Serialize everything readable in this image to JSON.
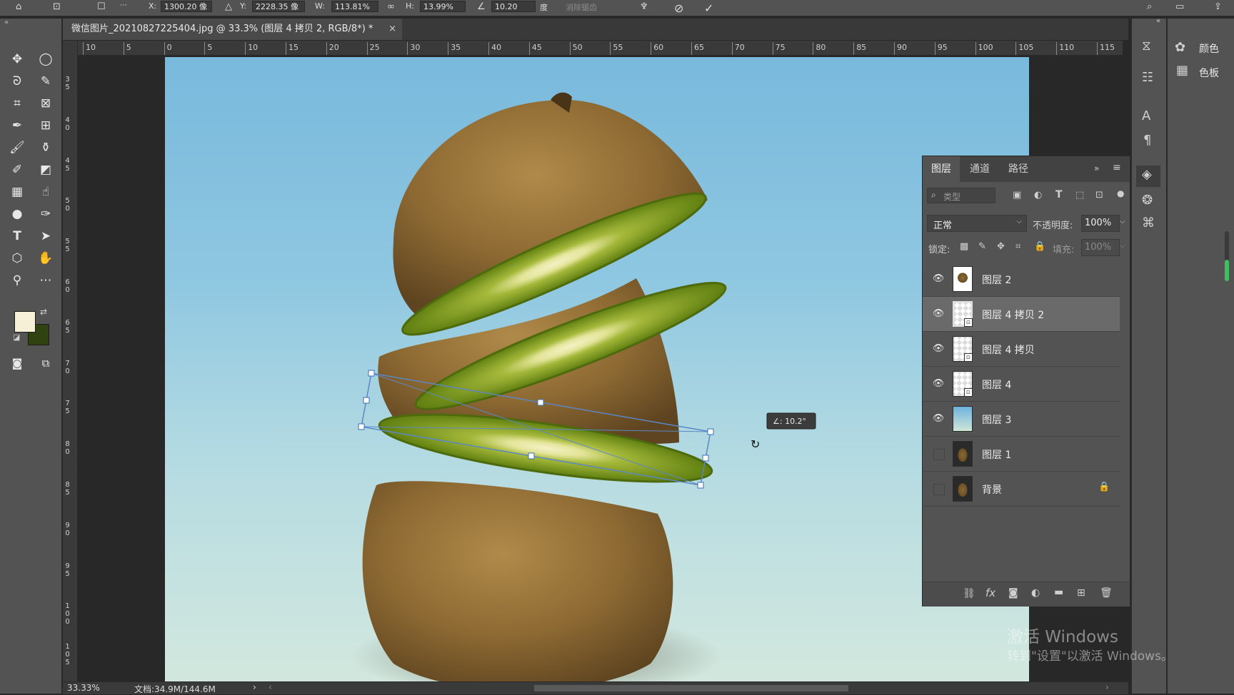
{
  "options_bar": {
    "x_label": "X:",
    "x_value": "1300.20 像",
    "y_label": "Y:",
    "y_value": "2228.35 像",
    "w_label": "W:",
    "w_value": "113.81%",
    "h_label": "H:",
    "h_value": "13.99%",
    "angle_value": "10.20",
    "angle_unit": "度",
    "interp_label": "消除锯齿"
  },
  "document": {
    "tab_title": "微信图片_20210827225404.jpg @ 33.3% (图层 4 拷贝 2, RGB/8*) *",
    "close_glyph": "×",
    "zoom": "33.33%",
    "doc_size": "文档:34.9M/144.6M"
  },
  "ruler_h": [
    "10",
    "5",
    "0",
    "5",
    "10",
    "15",
    "20",
    "25",
    "30",
    "35",
    "40",
    "45",
    "50",
    "55",
    "60",
    "65",
    "70",
    "75",
    "80",
    "85",
    "90",
    "95",
    "100",
    "105",
    "110",
    "115"
  ],
  "ruler_v": [
    [
      "3",
      "5"
    ],
    [
      "4",
      "0"
    ],
    [
      "4",
      "5"
    ],
    [
      "5",
      "0"
    ],
    [
      "5",
      "5"
    ],
    [
      "6",
      "0"
    ],
    [
      "6",
      "5"
    ],
    [
      "7",
      "0"
    ],
    [
      "7",
      "5"
    ],
    [
      "8",
      "0"
    ],
    [
      "8",
      "5"
    ],
    [
      "9",
      "0"
    ],
    [
      "9",
      "5"
    ],
    [
      "1",
      "0",
      "0"
    ],
    [
      "1",
      "0",
      "5"
    ]
  ],
  "transform": {
    "angle_tooltip": "∠: 10.2°"
  },
  "layers_panel": {
    "tabs": [
      "图层",
      "通道",
      "路径"
    ],
    "filter_placeholder": "类型",
    "blend_mode": "正常",
    "opacity_label": "不透明度:",
    "opacity_value": "100%",
    "lock_label": "锁定:",
    "fill_label": "填充:",
    "fill_value": "100%",
    "layers": [
      {
        "name": "图层 2",
        "visible": true,
        "selected": false,
        "smart": false,
        "thumb": "kiwi-slice"
      },
      {
        "name": "图层 4 拷贝 2",
        "visible": true,
        "selected": true,
        "smart": true,
        "thumb": "transparent"
      },
      {
        "name": "图层 4 拷贝",
        "visible": true,
        "selected": false,
        "smart": true,
        "thumb": "transparent"
      },
      {
        "name": "图层 4",
        "visible": true,
        "selected": false,
        "smart": true,
        "thumb": "transparent"
      },
      {
        "name": "图层 3",
        "visible": true,
        "selected": false,
        "smart": false,
        "thumb": "gradient"
      },
      {
        "name": "图层 1",
        "visible": false,
        "selected": false,
        "smart": false,
        "thumb": "kiwi"
      },
      {
        "name": "背景",
        "visible": false,
        "selected": false,
        "smart": false,
        "thumb": "kiwi",
        "locked": true
      }
    ]
  },
  "right_panel": {
    "color_label": "颜色",
    "swatches_label": "色板"
  },
  "colors": {
    "foreground": "#f6f0d6",
    "background": "#2f4210",
    "ui_panel": "#535353",
    "selection_row": "#6a6a6a"
  },
  "watermark": {
    "line1": "激活 Windows",
    "line2": "转到\"设置\"以激活 Windows。"
  }
}
